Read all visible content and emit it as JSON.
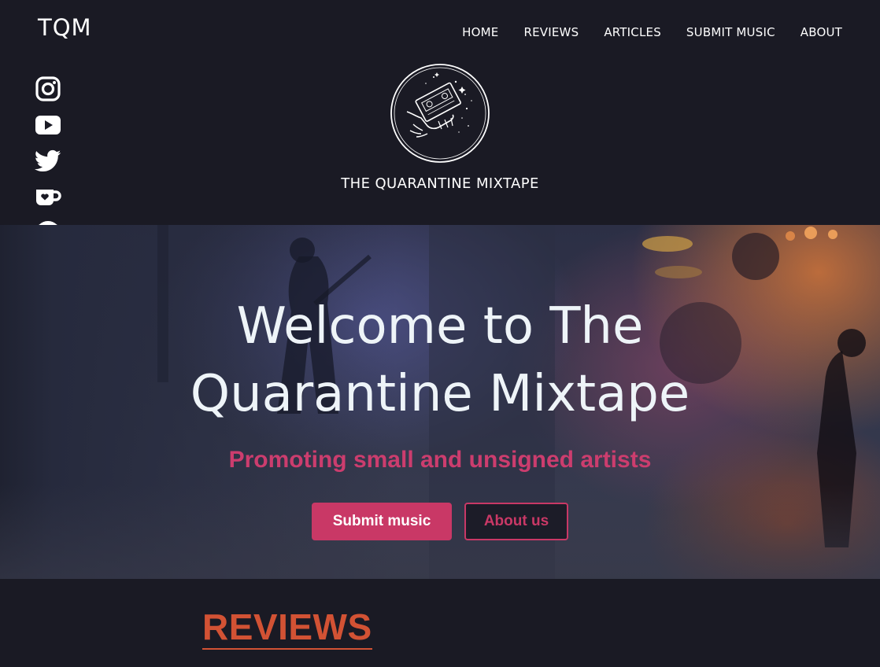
{
  "header": {
    "brand": "TQM",
    "nav": [
      "HOME",
      "REVIEWS",
      "ARTICLES",
      "SUBMIT MUSIC",
      "ABOUT"
    ]
  },
  "social": [
    "instagram-icon",
    "youtube-icon",
    "twitter-icon",
    "kofi-icon",
    "spotify-icon",
    "mail-icon"
  ],
  "logo": {
    "title": "THE QUARANTINE MIXTAPE"
  },
  "hero": {
    "title_line1": "Welcome to The",
    "title_line2": "Quarantine Mixtape",
    "subtitle": "Promoting small and unsigned artists",
    "primary_button": "Submit music",
    "secondary_button": "About us"
  },
  "section": {
    "heading": "REVIEWS"
  },
  "colors": {
    "background": "#1a1a24",
    "accent_pink": "#c93866",
    "accent_orange": "#d25234",
    "text": "#ffffff"
  }
}
